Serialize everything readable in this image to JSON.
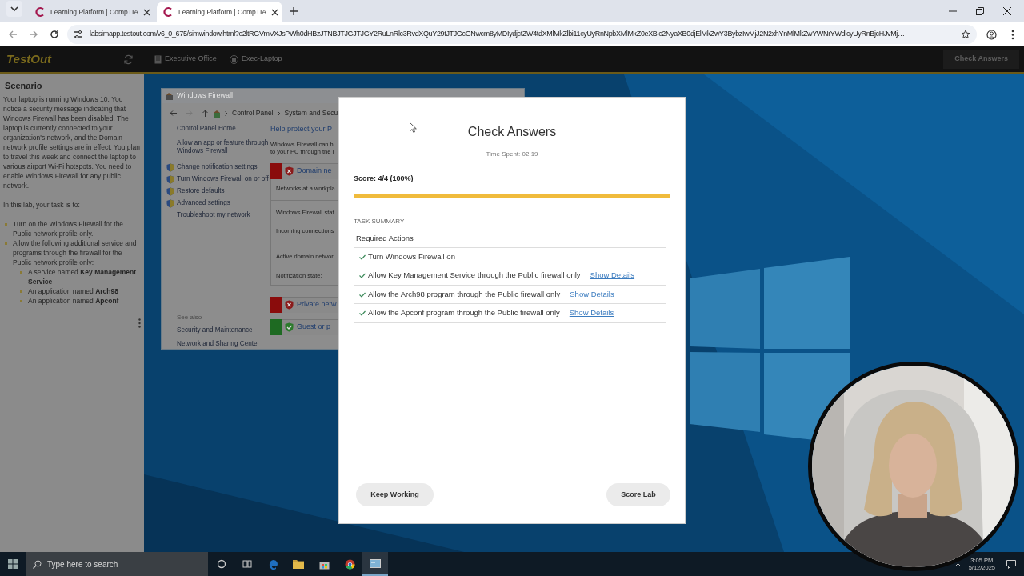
{
  "browser": {
    "tabs": [
      {
        "title": "Learning Platform | CompTIA",
        "selected": false
      },
      {
        "title": "Learning Platform | CompTIA",
        "selected": true
      }
    ],
    "url": "labsimapp.testout.com/v6_0_675/simwindow.html?c2ltRGVmVXJsPWh0dHBzJTNBJTJGJTJGY2RuLnRlc3RvdXQuY29tJTJGcGNwcm8yMDIydjctZW4tdXMlMkZlbi11cyUyRnNpbXMlMkZ0eXBlc2NyaXB0djElMkZwY3BybzIwMjJ2N2xhYnMlMkZwYWNrYWdlcyUyRnBjcHJvMj…"
  },
  "app_header": {
    "logo": "TestOut",
    "locations": [
      {
        "kind": "building",
        "label": "Executive Office"
      },
      {
        "kind": "computer",
        "label": "Exec-Laptop"
      }
    ],
    "check_button": "Check Answers"
  },
  "scenario": {
    "title": "Scenario",
    "description": "Your laptop is running Windows 10. You notice a security message indicating that Windows Firewall has been disabled. The laptop is currently connected to your organization's network, and the Domain network profile settings are in effect. You plan to travel this week and connect the laptop to various airport Wi-Fi hotspots. You need to enable Windows Firewall for any public network.",
    "task_intro": "In this lab, your task is to:",
    "tasks": [
      {
        "text": "Turn on the Windows Firewall for the Public network profile only."
      },
      {
        "text": "Allow the following additional service and programs through the firewall for the Public network profile only:",
        "children": [
          {
            "text": "A service named **Key Management Service**"
          },
          {
            "text": "An application named **Arch98**"
          },
          {
            "text": "An application named **Apconf**"
          }
        ]
      }
    ]
  },
  "firewall_window": {
    "title": "Windows Firewall",
    "breadcrumb": [
      "Control Panel",
      "System and Secu"
    ],
    "left_links": [
      {
        "text": "Control Panel Home",
        "shield": false
      },
      {
        "text": "Allow an app or feature through Windows Firewall",
        "shield": false
      },
      {
        "text": "Change notification settings",
        "shield": true
      },
      {
        "text": "Turn Windows Firewall on or off",
        "shield": true
      },
      {
        "text": "Restore defaults",
        "shield": true
      },
      {
        "text": "Advanced settings",
        "shield": true
      },
      {
        "text": "Troubleshoot my network",
        "shield": false
      }
    ],
    "see_also_title": "See also",
    "see_also": [
      "Security and Maintenance",
      "Network and Sharing Center"
    ],
    "heading": "Help protect your P",
    "description": [
      "Windows Firewall can h",
      "to your PC through the I"
    ],
    "profiles": [
      {
        "name": "Domain ne",
        "enabled": false,
        "details": [
          "Networks at a workpla",
          "Windows Firewall stat",
          "Incoming connections",
          "Active domain networ",
          "Notification state:"
        ]
      },
      {
        "name": "Private netw",
        "enabled": false
      },
      {
        "name": "Guest or p",
        "enabled": true
      }
    ]
  },
  "check_answers": {
    "title": "Check Answers",
    "time_spent": "Time Spent: 02:19",
    "score": "Score: 4/4 (100%)",
    "level": 1,
    "summary_title": "TASK SUMMARY",
    "section_title": "Required Actions",
    "actions": [
      {
        "text": "Turn Windows Firewall on",
        "passed": true
      },
      {
        "text": "Allow Key Management Service through the Public firewall only",
        "passed": true,
        "link": "Show Details"
      },
      {
        "text": "Allow the Arch98 program through the Public firewall only",
        "passed": true,
        "link": "Show Details"
      },
      {
        "text": "Allow the Apconf program through the Public firewall only",
        "passed": true,
        "link": "Show Details"
      }
    ],
    "buttons": [
      "Keep Working",
      "Score Lab"
    ]
  },
  "taskbar": {
    "search_placeholder": "Type here to search",
    "apps": [
      {
        "kind": "cortana",
        "active": false
      },
      {
        "kind": "taskview",
        "active": false
      },
      {
        "kind": "edge",
        "active": false
      },
      {
        "kind": "explorer",
        "active": false
      },
      {
        "kind": "store",
        "active": false
      },
      {
        "kind": "chrome",
        "active": false
      },
      {
        "kind": "window",
        "active": true
      }
    ],
    "time": "3:05 PM",
    "date": "5/12/2025"
  }
}
